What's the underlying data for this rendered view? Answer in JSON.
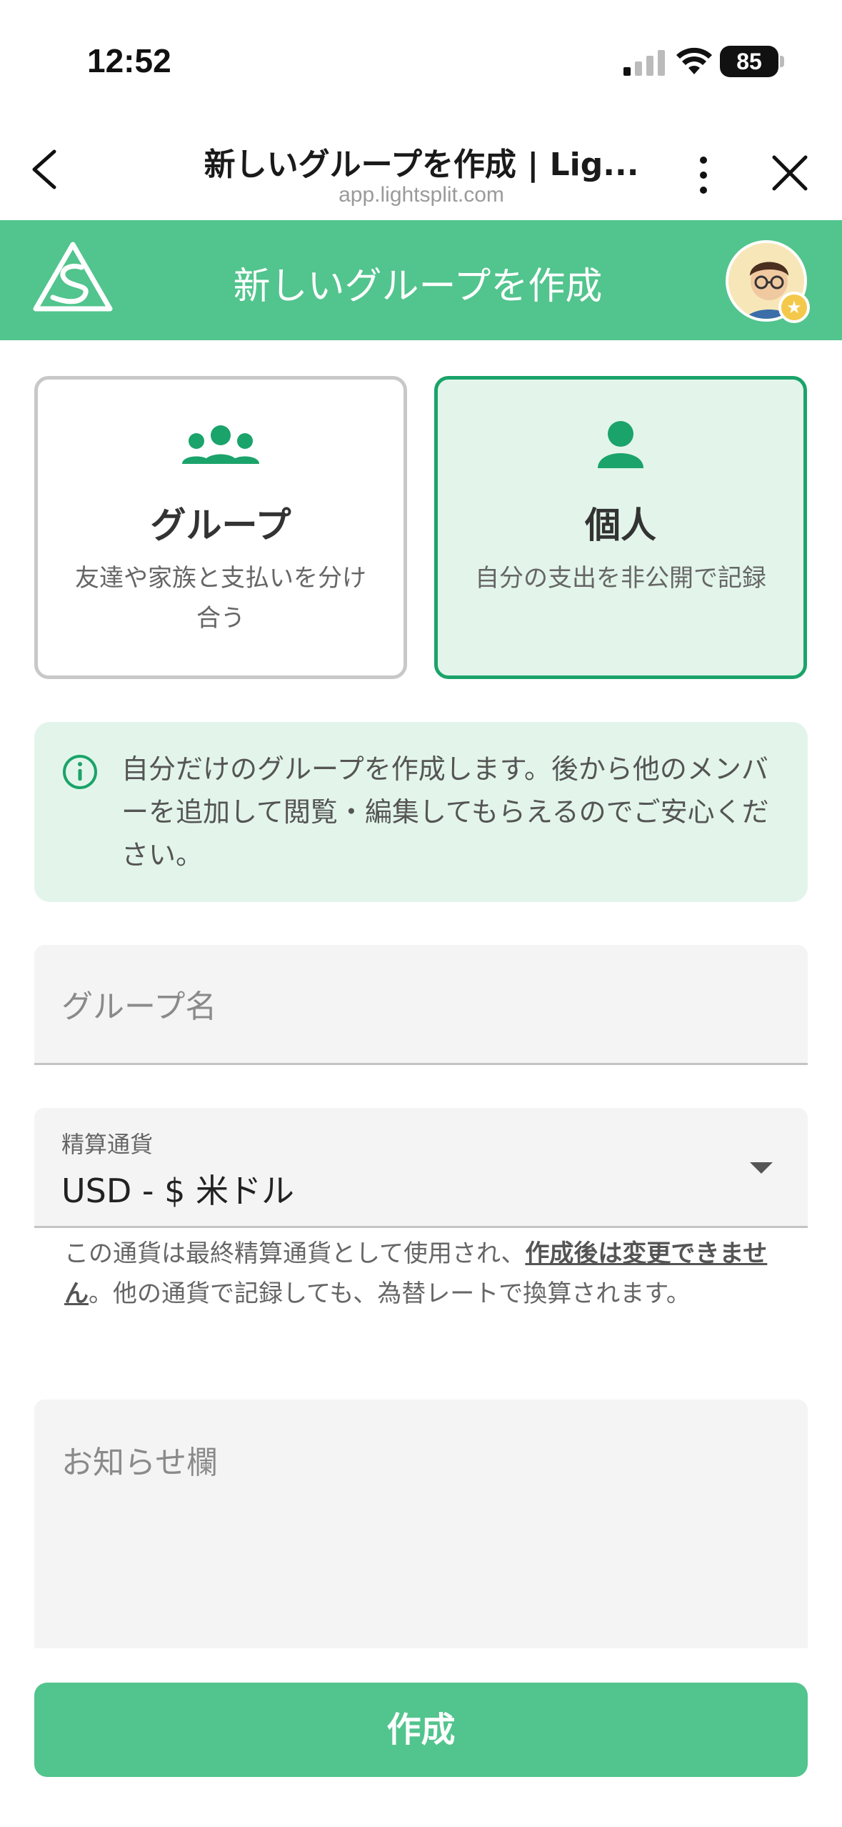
{
  "status_bar": {
    "time": "12:52",
    "battery": "85"
  },
  "browser": {
    "title": "新しいグループを作成 | Lig...",
    "url": "app.lightsplit.com"
  },
  "app_header": {
    "title": "新しいグループを作成"
  },
  "mode_cards": [
    {
      "title": "グループ",
      "description": "友達や家族と支払いを分け合う",
      "selected": false
    },
    {
      "title": "個人",
      "description": "自分の支出を非公開で記録",
      "selected": true
    }
  ],
  "info": {
    "text": "自分だけのグループを作成します。後から他のメンバーを追加して閲覧・編集してもらえるのでご安心ください。"
  },
  "form": {
    "group_name_placeholder": "グループ名",
    "currency_label": "精算通貨",
    "currency_value": "USD - $ 米ドル",
    "helper_before": "この通貨は最終精算通貨として使用され、",
    "helper_emphasis": "作成後は変更できません",
    "helper_after": "。他の通貨で記録しても、為替レートで換算されます。",
    "notice_placeholder": "お知らせ欄"
  },
  "submit_label": "作成",
  "colors": {
    "brand": "#52c48d",
    "accent": "#1aa36a",
    "selected_bg": "#e3f5eb"
  }
}
